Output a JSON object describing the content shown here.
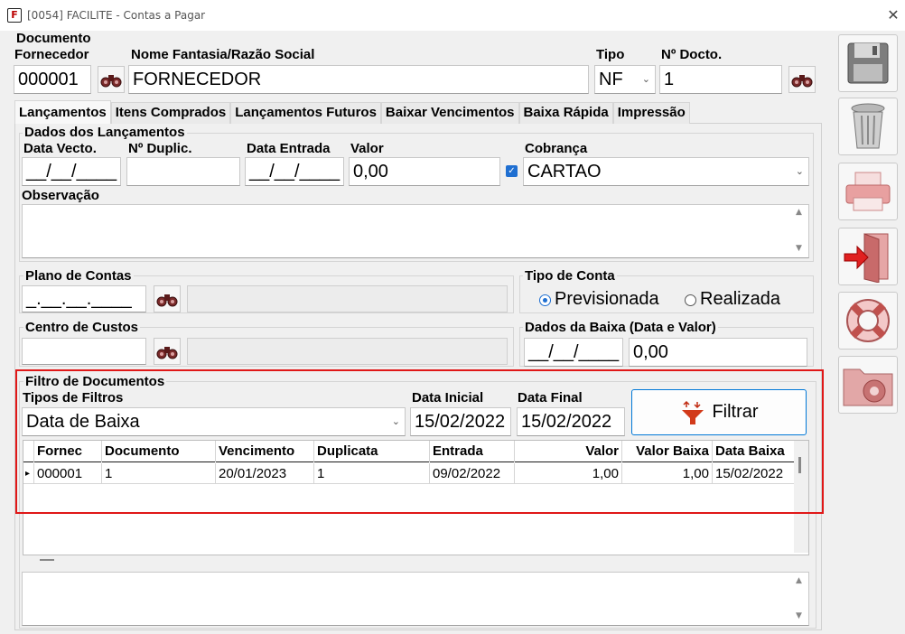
{
  "window": {
    "title": "[0054] FACILITE - Contas a Pagar",
    "close_glyph": "✕",
    "icon_letter": "F"
  },
  "header": {
    "section_label": "Documento",
    "fornecedor_label": "Fornecedor",
    "fornecedor_value": "000001",
    "nome_label": "Nome Fantasia/Razão Social",
    "nome_value": "FORNECEDOR",
    "tipo_label": "Tipo",
    "tipo_value": "NF",
    "ndocto_label": "Nº Docto.",
    "ndocto_value": "1"
  },
  "tabs": [
    {
      "label": "Lançamentos"
    },
    {
      "label": "Itens Comprados"
    },
    {
      "label": "Lançamentos Futuros"
    },
    {
      "label": "Baixar Vencimentos"
    },
    {
      "label": "Baixa Rápida"
    },
    {
      "label": "Impressão"
    }
  ],
  "lancamentos": {
    "group_label": "Dados dos Lançamentos",
    "data_vecto_label": "Data Vecto.",
    "data_vecto_value": "__/__/____",
    "nduplic_label": "Nº Duplic.",
    "nduplic_value": "",
    "data_entrada_label": "Data Entrada",
    "data_entrada_value": "__/__/____",
    "valor_label": "Valor",
    "valor_value": "0,00",
    "cobranca_label": "Cobrança",
    "cobranca_value": "CARTAO",
    "observacao_label": "Observação",
    "observacao_value": ""
  },
  "plano": {
    "label": "Plano de Contas",
    "value": "_.__.__.____",
    "desc": ""
  },
  "tipo_conta": {
    "label": "Tipo de Conta",
    "options": [
      "Previsionada",
      "Realizada"
    ],
    "selected": "Previsionada"
  },
  "centro": {
    "label": "Centro de Custos",
    "value": "",
    "desc": ""
  },
  "baixa": {
    "label": "Dados da Baixa (Data e Valor)",
    "data_value": "__/__/____",
    "valor_value": "0,00"
  },
  "filtro": {
    "group_label": "Filtro de Documentos",
    "tipos_label": "Tipos de Filtros",
    "tipos_value": "Data de Baixa",
    "data_inicial_label": "Data Inicial",
    "data_inicial_value": "15/02/2022",
    "data_final_label": "Data Final",
    "data_final_value": "15/02/2022",
    "filtrar_label": "Filtrar"
  },
  "grid": {
    "columns": [
      "Fornec",
      "Documento",
      "Vencimento",
      "Duplicata",
      "Entrada",
      "Valor",
      "Valor Baixa",
      "Data Baixa"
    ],
    "rows": [
      [
        "000001",
        "1",
        "20/01/2023",
        "1",
        "09/02/2022",
        "1,00",
        "1,00",
        "15/02/2022"
      ]
    ],
    "row_indicator": "▸"
  },
  "colors": {
    "accent": "#1f6fd1",
    "highlight_box": "#e01818",
    "window_bg": "#f0f0f0"
  },
  "sidebar_icons": [
    "save-icon",
    "trash-icon",
    "printer-icon",
    "exit-door-icon",
    "lifebuoy-icon",
    "folder-gear-icon"
  ]
}
